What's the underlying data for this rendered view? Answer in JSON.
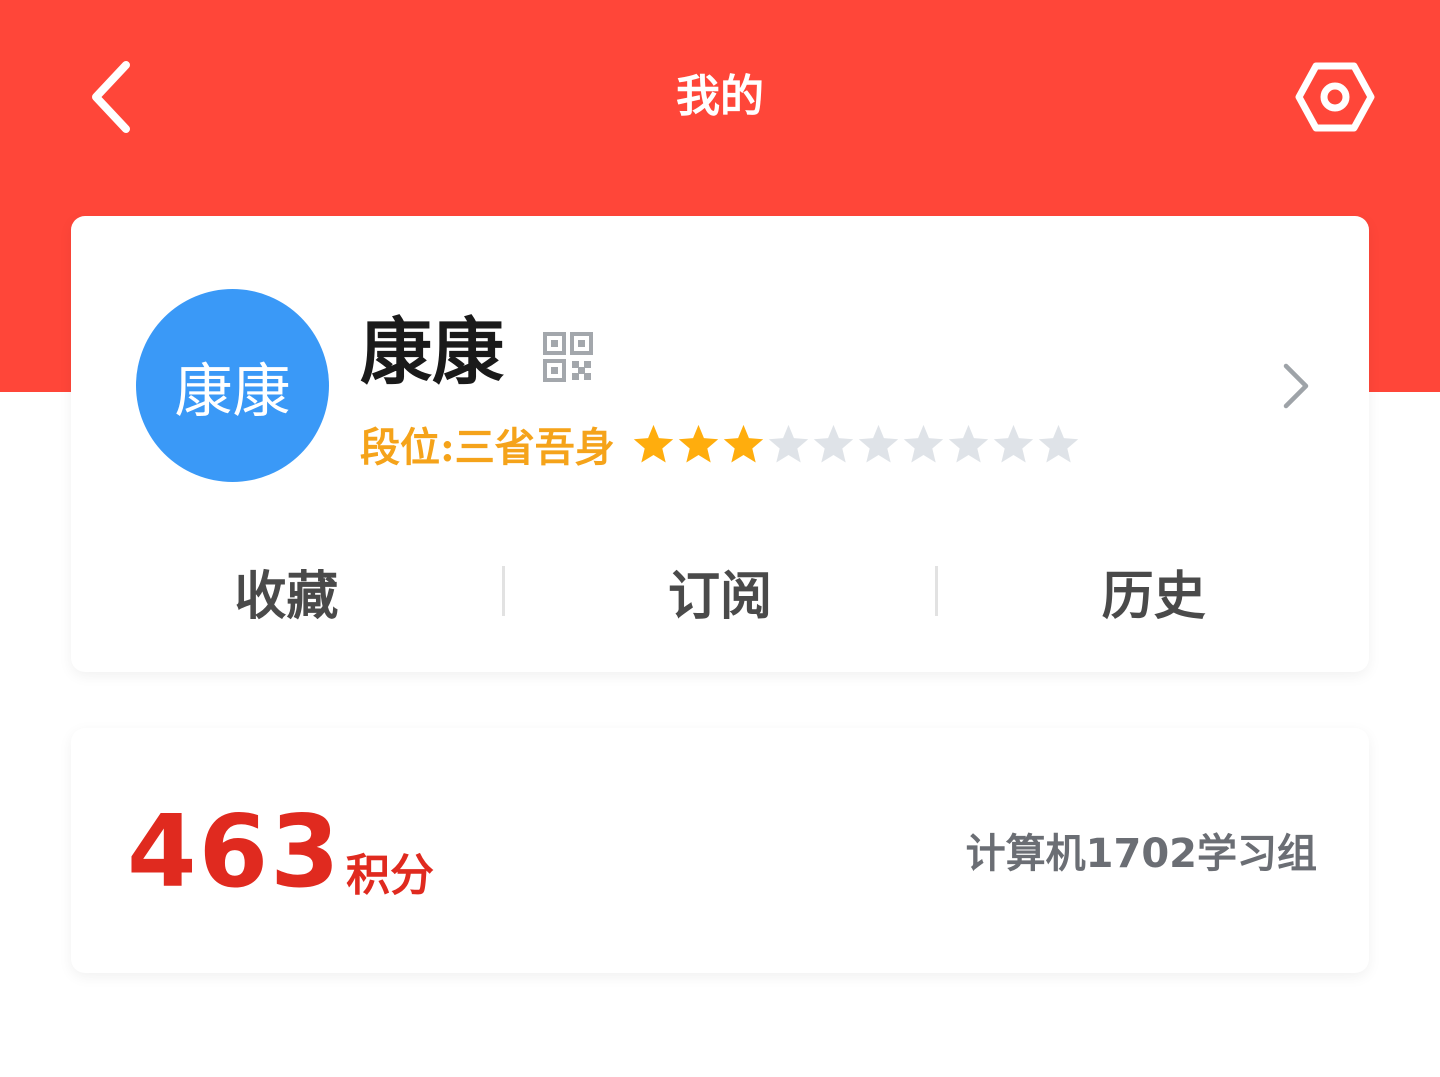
{
  "header": {
    "title": "我的",
    "back_icon": "chevron-left-icon",
    "settings_icon": "hexagon-gear-icon",
    "bg_color": "#ff4639"
  },
  "profile": {
    "avatar_text": "康康",
    "avatar_color": "#3a99f7",
    "name": "康康",
    "qr_icon": "qr-code-icon",
    "rank_label": "段位:三省吾身",
    "rank_color": "#f5a31a",
    "stars_filled": 3,
    "stars_total": 10,
    "star_filled_color": "#ffad0d",
    "star_empty_color": "#dfe3e8",
    "arrow_icon": "chevron-right-icon"
  },
  "tabs": [
    {
      "label": "收藏"
    },
    {
      "label": "订阅"
    },
    {
      "label": "历史"
    }
  ],
  "points": {
    "value": "463",
    "unit": "积分",
    "group": "计算机1702学习组",
    "accent_color": "#e02a1f"
  }
}
